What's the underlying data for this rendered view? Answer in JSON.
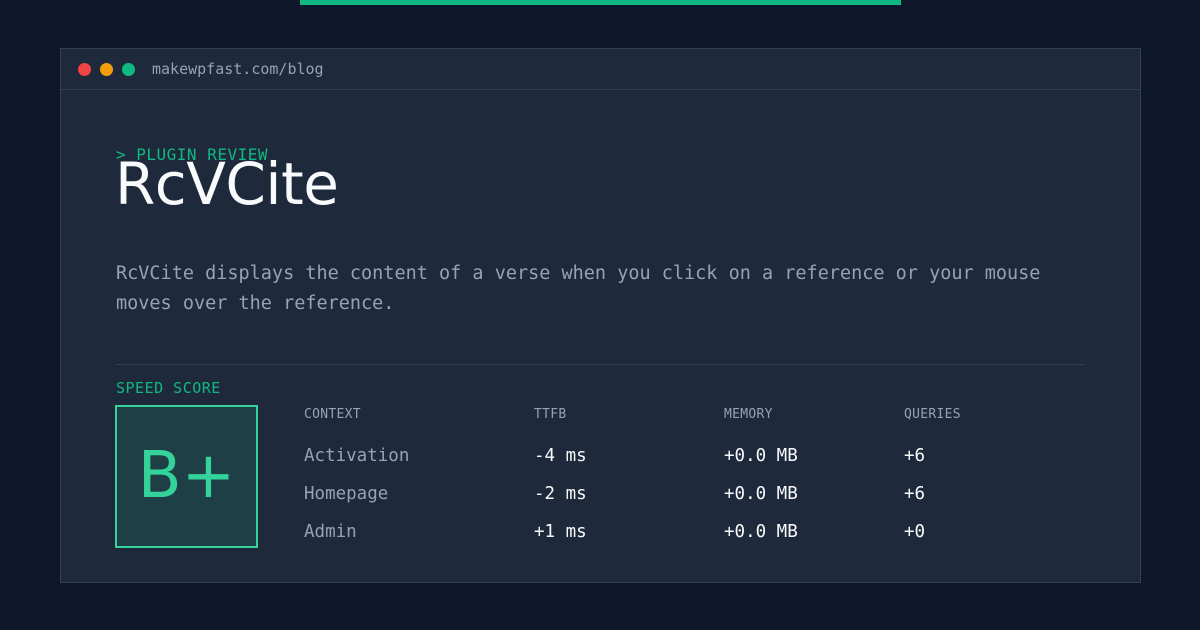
{
  "window": {
    "url": "makewpfast.com/blog"
  },
  "article": {
    "eyebrow": "> PLUGIN REVIEW",
    "title": "RcVCite",
    "description": "RcVCite displays the content of a verse when you click on a reference or your mouse moves over the reference."
  },
  "speed": {
    "label": "SPEED SCORE",
    "grade": "B+"
  },
  "table": {
    "headers": [
      "CONTEXT",
      "TTFB",
      "MEMORY",
      "QUERIES"
    ],
    "rows": [
      {
        "context": "Activation",
        "ttfb": "-4 ms",
        "memory": "+0.0 MB",
        "queries": "+6"
      },
      {
        "context": "Homepage",
        "ttfb": "-2 ms",
        "memory": "+0.0 MB",
        "queries": "+6"
      },
      {
        "context": "Admin",
        "ttfb": "+1 ms",
        "memory": "+0.0 MB",
        "queries": "+0"
      }
    ]
  },
  "colors": {
    "background": "#0f172a",
    "panel": "#1e293b",
    "accent": "#10b981",
    "grade": "#34d399",
    "muted": "#94a3b8",
    "text": "#f8fafc"
  },
  "icons": {
    "window_controls": [
      "close-dot-icon",
      "minimize-dot-icon",
      "maximize-dot-icon"
    ]
  }
}
